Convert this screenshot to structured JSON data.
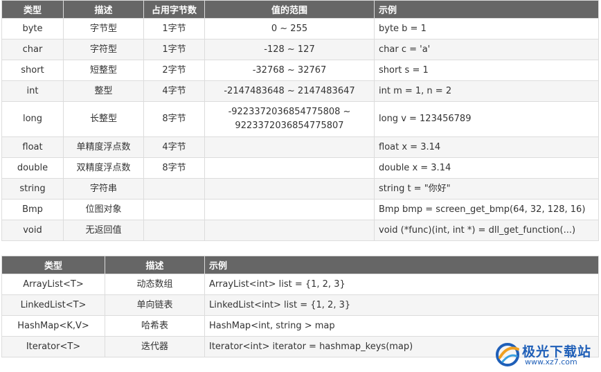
{
  "table1": {
    "headers": [
      "类型",
      "描述",
      "占用字节数",
      "值的范围",
      "示例"
    ],
    "rows": [
      {
        "type": "byte",
        "desc": "字节型",
        "bytes": "1字节",
        "range": "0 ~ 255",
        "example": "byte b = 1"
      },
      {
        "type": "char",
        "desc": "字符型",
        "bytes": "1字节",
        "range": "-128 ~ 127",
        "example": "char c = 'a'"
      },
      {
        "type": "short",
        "desc": "短整型",
        "bytes": "2字节",
        "range": "-32768 ~ 32767",
        "example": "short s = 1"
      },
      {
        "type": "int",
        "desc": "整型",
        "bytes": "4字节",
        "range": "-2147483648 ~ 2147483647",
        "example": "int m = 1, n = 2"
      },
      {
        "type": "long",
        "desc": "长整型",
        "bytes": "8字节",
        "range_line1": "-9223372036854775808 ~",
        "range_line2": "9223372036854775807",
        "example": "long v = 123456789"
      },
      {
        "type": "float",
        "desc": "单精度浮点数",
        "bytes": "4字节",
        "range": "",
        "example": "float x = 3.14"
      },
      {
        "type": "double",
        "desc": "双精度浮点数",
        "bytes": "8字节",
        "range": "",
        "example": "double x = 3.14"
      },
      {
        "type": "string",
        "desc": "字符串",
        "bytes": "",
        "range": "",
        "example": "string t = \"你好\""
      },
      {
        "type": "Bmp",
        "desc": "位图对象",
        "bytes": "",
        "range": "",
        "example": "Bmp bmp = screen_get_bmp(64, 32, 128, 16)"
      },
      {
        "type": "void",
        "desc": "无返回值",
        "bytes": "",
        "range": "",
        "example": "void (*func)(int, int *) = dll_get_function(...)"
      }
    ]
  },
  "table2": {
    "headers": [
      "类型",
      "描述",
      "示例"
    ],
    "rows": [
      {
        "type": "ArrayList<T>",
        "desc": "动态数组",
        "example": "ArrayList<int> list = {1, 2, 3}"
      },
      {
        "type": "LinkedList<T>",
        "desc": "单向链表",
        "example": "LinkedList<int> list = {1, 2, 3}"
      },
      {
        "type": "HashMap<K,V>",
        "desc": "哈希表",
        "example": "HashMap<int, string > map"
      },
      {
        "type": "Iterator<T>",
        "desc": "迭代器",
        "example": "Iterator<int> iterator = hashmap_keys(map)"
      }
    ]
  },
  "watermark": {
    "brand": "极光下载站",
    "url": "www.xz7.com",
    "colors": {
      "brand_blue": "#1f5fb8",
      "header_gray": "#666666",
      "alt_row": "#f5f5f5"
    }
  }
}
